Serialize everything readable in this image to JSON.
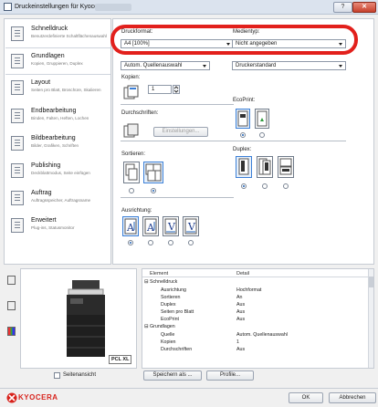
{
  "window": {
    "title": "Druckeinstellungen für Kyocera",
    "help_label": "?",
    "close_label": "✕"
  },
  "sidebar": {
    "items": [
      {
        "label": "Schnelldruck",
        "sub": "Benutzerdefinierte Schaltflächenauswahl",
        "icon": "quick-print-icon"
      },
      {
        "label": "Grundlagen",
        "sub": "Kopien, Gruppieren, Duplex",
        "icon": "basics-icon"
      },
      {
        "label": "Layout",
        "sub": "Seiten pro Blatt, Broschüre, Skalieren",
        "icon": "layout-icon"
      },
      {
        "label": "Endbearbeitung",
        "sub": "Binden, Falten, Heften, Lochen",
        "icon": "finishing-icon"
      },
      {
        "label": "Bildbearbeitung",
        "sub": "Bilder, Grafiken, Schriften",
        "icon": "imaging-icon"
      },
      {
        "label": "Publishing",
        "sub": "Deckblattmodus, Seite einfügen",
        "icon": "publishing-icon"
      },
      {
        "label": "Auftrag",
        "sub": "Auftragsspeicher, Auftragsname",
        "icon": "job-icon"
      },
      {
        "label": "Erweitert",
        "sub": "Plug-ins, Statusmonitor",
        "icon": "advanced-icon"
      }
    ]
  },
  "main": {
    "druckformat_label": "Druckformat:",
    "druckformat_value": "A4 [100%]",
    "medientyp_label": "Medientyp:",
    "medientyp_value": "Nicht angegeben",
    "source_value": "Autom. Quellenauswahl",
    "druckerstandard_value": "Druckerstandard",
    "kopien_label": "Kopien:",
    "kopien_value": "1",
    "ecoprint_label": "EcoPrint:",
    "durchschriften_label": "Durchschriften:",
    "einstellungen_label": "Einstellungen...",
    "duplex_label": "Duplex:",
    "sortieren_label": "Sortieren:",
    "ausrichtung_label": "Ausrichtung:"
  },
  "preview": {
    "pcl_label": "PCL XL"
  },
  "table": {
    "headers": [
      "Element",
      "Detail"
    ],
    "rows": [
      {
        "type": "group",
        "element": "Schnelldruck",
        "detail": ""
      },
      {
        "type": "item",
        "element": "Ausrichtung",
        "detail": "Hochformat"
      },
      {
        "type": "item",
        "element": "Sortieren",
        "detail": "An"
      },
      {
        "type": "item",
        "element": "Duplex",
        "detail": "Aus"
      },
      {
        "type": "item",
        "element": "Seiten pro Blatt",
        "detail": "Aus"
      },
      {
        "type": "item",
        "element": "EcoPrint",
        "detail": "Aus"
      },
      {
        "type": "group",
        "element": "Grundlagen",
        "detail": ""
      },
      {
        "type": "item",
        "element": "Quelle",
        "detail": "Autom. Quellenauswahl"
      },
      {
        "type": "item",
        "element": "Kopien",
        "detail": "1"
      },
      {
        "type": "item",
        "element": "Durchschriften",
        "detail": "Aus"
      }
    ]
  },
  "bottom": {
    "seitenansicht_label": "Seitenansicht",
    "speichern_label": "Speichern als ...",
    "profile_label": "Profile..."
  },
  "footer": {
    "logo_text": "KYOCERA",
    "ok_label": "OK",
    "abbrechen_label": "Abbrechen"
  },
  "colors": {
    "accent": "#1e5fb3",
    "highlight_oval": "#e2201c",
    "brand_red": "#d8231c"
  }
}
